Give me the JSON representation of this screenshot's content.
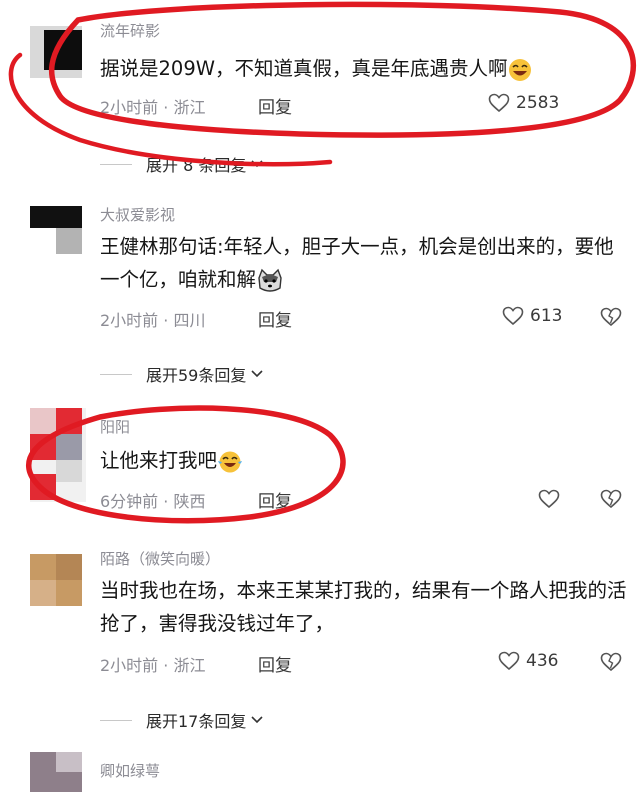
{
  "comments": [
    {
      "username": "流年碎影",
      "text": "据说是209W，不知道真假，真是年底遇贵人啊",
      "emoji": "laughing-face-emoji",
      "time": "2小时前",
      "location": "浙江",
      "reply_label": "回复",
      "likes": "2583",
      "expand_label": "展开 8 条回复"
    },
    {
      "username": "大叔爱影视",
      "text": "王健林那句话:年轻人，胆子大一点，机会是创出来的，要他一个亿，咱就和解",
      "emoji": "shiba-dog-emoji",
      "time": "2小时前",
      "location": "四川",
      "reply_label": "回复",
      "likes": "613",
      "expand_label": "展开59条回复"
    },
    {
      "username": "阳阳",
      "text": "让他来打我吧",
      "emoji": "tears-of-joy-emoji",
      "time": "6分钟前",
      "location": "陕西",
      "reply_label": "回复",
      "likes": ""
    },
    {
      "username": "陌路（微笑向暖）",
      "text": "当时我也在场，本来王某某打我的，结果有一个路人把我的活抢了，害得我没钱过年了，",
      "time": "2小时前",
      "location": "浙江",
      "reply_label": "回复",
      "likes": "436",
      "expand_label": "展开17条回复"
    },
    {
      "username": "卿如绿萼"
    }
  ],
  "colors": {
    "highlight_ring": "#e01a22",
    "meta_gray": "#8c8c94"
  }
}
